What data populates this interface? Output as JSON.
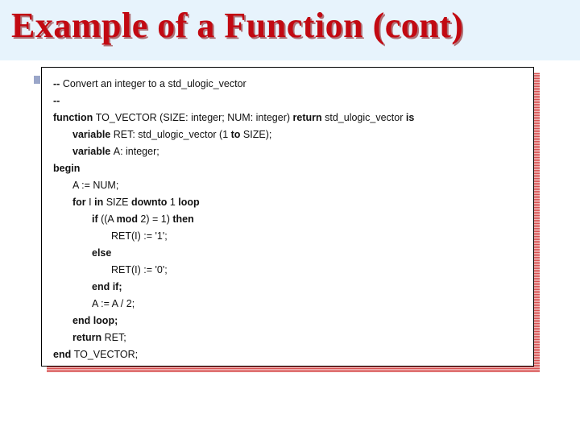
{
  "title": "Example of a Function (cont)",
  "code": {
    "l01a": "-- ",
    "l01b": "Convert an integer to a std_ulogic_vector",
    "l02": "--",
    "l03a": "function ",
    "l03b": "TO_VECTOR (SIZE: integer; NUM: integer) ",
    "l03c": "return ",
    "l03d": "std_ulogic_vector ",
    "l03e": "is",
    "l04a": "variable ",
    "l04b": "RET: std_ulogic_vector (1 ",
    "l04c": "to ",
    "l04d": "SIZE);",
    "l05a": "variable ",
    "l05b": "A: integer;",
    "l06": "begin",
    "l07": "A := NUM;",
    "l08a": "for ",
    "l08b": "I ",
    "l08c": "in ",
    "l08d": "SIZE ",
    "l08e": "downto ",
    "l08f": "1 ",
    "l08g": "loop",
    "l09a": "if ",
    "l09b": "((A ",
    "l09c": "mod ",
    "l09d": "2) = 1) ",
    "l09e": "then",
    "l10": "RET(I) := '1';",
    "l11": "else",
    "l12": "RET(I) := '0';",
    "l13": "end if;",
    "l14": "A := A / 2;",
    "l15": "end loop;",
    "l16a": "return ",
    "l16b": "RET;",
    "l17a": "end ",
    "l17b": "TO_VECTOR;"
  }
}
